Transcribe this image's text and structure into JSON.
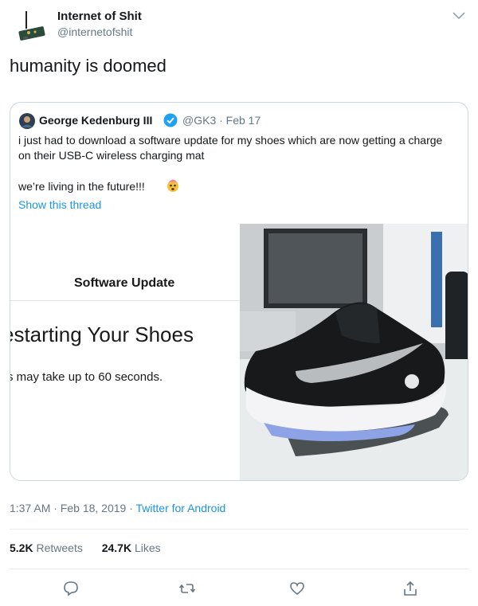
{
  "account": {
    "name": "Internet of Shit",
    "handle": "@internetofshit"
  },
  "tweet": {
    "text": "humanity is doomed",
    "timestamp": "1:37 AM · Feb 18, 2019 · ",
    "source": "Twitter for Android"
  },
  "quoted": {
    "name": "George Kedenburg III",
    "handle_date": "@GK3 · Feb 17",
    "text": "i just had to download a software update for my shoes which are now getting a charge on their USB-C wireless charging mat",
    "text2": "we’re living in the future!!!",
    "thread_link": "Show this thread",
    "media": {
      "update_title": "Software Update",
      "restart_text": "estarting Your Shoes",
      "duration_text": "s may take up to 60 seconds."
    }
  },
  "stats": {
    "retweets_count": "5.2K",
    "retweets_label": "Retweets",
    "likes_count": "24.7K",
    "likes_label": "Likes"
  },
  "icons": {
    "reply": "reply-icon",
    "retweet": "retweet-icon",
    "like": "like-icon",
    "share": "share-icon"
  },
  "colors": {
    "link": "#1b95e0",
    "muted": "#657786",
    "border": "#ccd6dd"
  }
}
